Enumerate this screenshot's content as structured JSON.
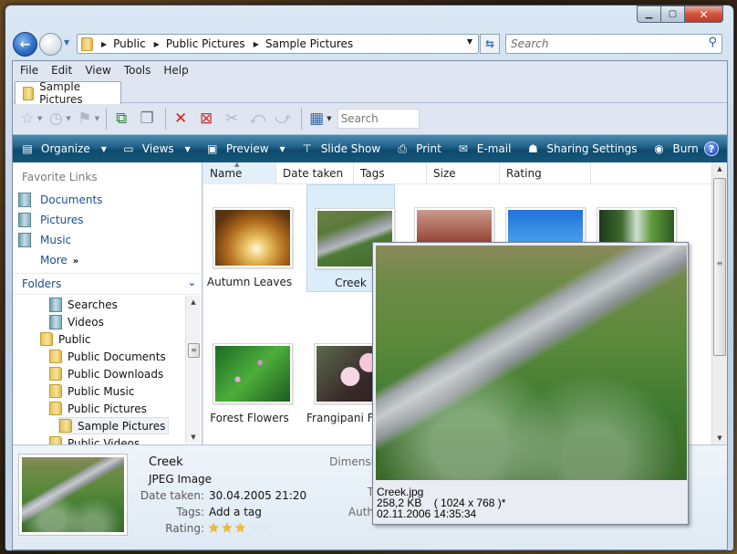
{
  "window": {
    "caption_buttons": {
      "minimize": "minimize",
      "maximize": "maximize",
      "close": "close"
    }
  },
  "nav": {
    "breadcrumbs": [
      "Public",
      "Public Pictures",
      "Sample Pictures"
    ],
    "search_placeholder": "Search"
  },
  "menubar": [
    "File",
    "Edit",
    "View",
    "Tools",
    "Help"
  ],
  "tab": {
    "label": "Sample Pictures"
  },
  "toolbar": {
    "search_placeholder": "Search"
  },
  "commands": [
    {
      "label": "Organize",
      "icon": "organize-icon",
      "dropdown": true
    },
    {
      "label": "Views",
      "icon": "views-icon",
      "dropdown": true
    },
    {
      "label": "Preview",
      "icon": "preview-icon",
      "dropdown": true
    },
    {
      "label": "Slide Show",
      "icon": "slideshow-icon",
      "dropdown": false
    },
    {
      "label": "Print",
      "icon": "printer-icon",
      "dropdown": false
    },
    {
      "label": "E-mail",
      "icon": "email-icon",
      "dropdown": false
    },
    {
      "label": "Sharing Settings",
      "icon": "sharing-icon",
      "dropdown": false
    },
    {
      "label": "Burn",
      "icon": "burn-icon",
      "dropdown": false
    }
  ],
  "favorites": {
    "title": "Favorite Links",
    "items": [
      "Documents",
      "Pictures",
      "Music"
    ],
    "more": "More"
  },
  "folders": {
    "title": "Folders",
    "tree": [
      {
        "label": "Searches",
        "level": 2,
        "kind": "lib"
      },
      {
        "label": "Videos",
        "level": 2,
        "kind": "lib"
      },
      {
        "label": "Public",
        "level": 1,
        "kind": "folder"
      },
      {
        "label": "Public Documents",
        "level": 2,
        "kind": "folder"
      },
      {
        "label": "Public Downloads",
        "level": 2,
        "kind": "folder"
      },
      {
        "label": "Public Music",
        "level": 2,
        "kind": "folder"
      },
      {
        "label": "Public Pictures",
        "level": 2,
        "kind": "folder"
      },
      {
        "label": "Sample Pictures",
        "level": 3,
        "kind": "folder",
        "selected": true
      },
      {
        "label": "Public Videos",
        "level": 2,
        "kind": "folder"
      }
    ]
  },
  "columns": [
    "Name",
    "Date taken",
    "Tags",
    "Size",
    "Rating"
  ],
  "items": [
    {
      "label": "Autumn Leaves",
      "img": "autumn"
    },
    {
      "label": "Creek",
      "img": "creek",
      "selected": true
    },
    {
      "label": "",
      "img": "desert"
    },
    {
      "label": "",
      "img": "sky"
    },
    {
      "label": "",
      "img": "forest"
    },
    {
      "label": "Forest Flowers",
      "img": "flowers"
    },
    {
      "label": "Frangipani Flowers",
      "img": "frangi"
    }
  ],
  "details": {
    "name": "Creek",
    "type": "JPEG Image",
    "date_taken_label": "Date taken:",
    "date_taken": "30.04.2005 21:20",
    "tags_label": "Tags:",
    "tags": "Add a tag",
    "rating_label": "Rating:",
    "rating": 3,
    "rating_max": 5,
    "dimensions_label": "Dimensi",
    "t_label": "T",
    "authors_label": "Auth"
  },
  "preview": {
    "filename": "Creek.jpg",
    "size_line": "258,2 KB    ( 1024 x 768 )*",
    "date": "02.11.2006 14:35:34"
  }
}
